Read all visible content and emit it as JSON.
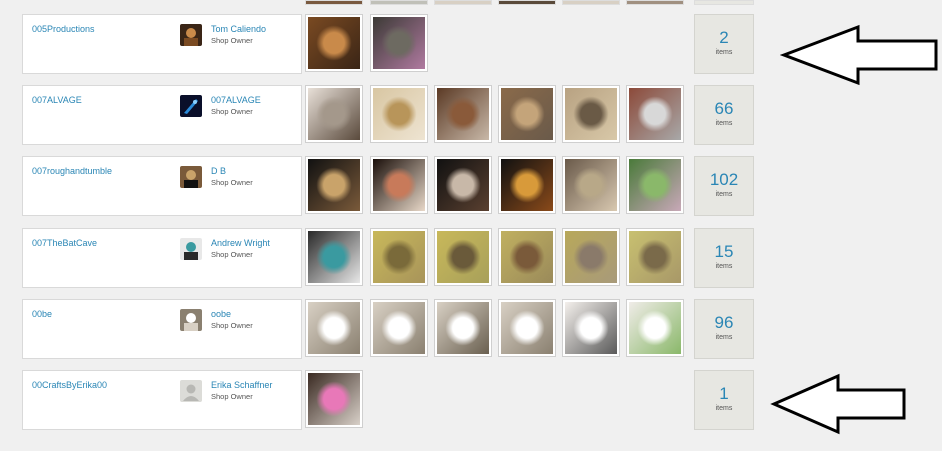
{
  "shops": [
    {
      "shop_name": "005Productions",
      "owner_name": "Tom Caliendo",
      "owner_role": "Shop Owner",
      "avatar_icon": "user-photo-icon",
      "thumbs": [
        {
          "alt": "listing-photo",
          "colors": [
            "#7a4a22",
            "#c98a4a",
            "#3a2516"
          ]
        },
        {
          "alt": "listing-photo",
          "colors": [
            "#3c3a36",
            "#6d6a61",
            "#b07aa0"
          ]
        }
      ],
      "item_count": "2",
      "items_label": "items",
      "highlight": true
    },
    {
      "shop_name": "007ALVAGE",
      "owner_name": "007ALVAGE",
      "owner_role": "Shop Owner",
      "avatar_icon": "blue-logo-icon",
      "thumbs": [
        {
          "alt": "listing-photo",
          "colors": [
            "#e8e0d8",
            "#a4988b",
            "#5a4a3c"
          ]
        },
        {
          "alt": "listing-photo",
          "colors": [
            "#d8c6a2",
            "#b8955a",
            "#eee4d2"
          ]
        },
        {
          "alt": "listing-photo",
          "colors": [
            "#5b3a25",
            "#8a5a3a",
            "#c8b8a8"
          ]
        },
        {
          "alt": "listing-photo",
          "colors": [
            "#8a6a4a",
            "#c4a47a",
            "#6a5a4a"
          ]
        },
        {
          "alt": "listing-photo",
          "colors": [
            "#b8a282",
            "#6a5a46",
            "#d8c8a8"
          ]
        },
        {
          "alt": "listing-photo",
          "colors": [
            "#8c4a3a",
            "#d8d8d8",
            "#a8a8a8"
          ]
        }
      ],
      "item_count": "66",
      "items_label": "items",
      "highlight": false
    },
    {
      "shop_name": "007roughandtumble",
      "owner_name": "D B",
      "owner_role": "Shop Owner",
      "avatar_icon": "user-photo-icon",
      "thumbs": [
        {
          "alt": "listing-photo",
          "colors": [
            "#111111",
            "#c9a36a",
            "#7a5a3a"
          ]
        },
        {
          "alt": "listing-photo",
          "colors": [
            "#1a0f0a",
            "#c87a5a",
            "#e8d8c8"
          ]
        },
        {
          "alt": "listing-photo",
          "colors": [
            "#111111",
            "#c8b8a8",
            "#5a4030"
          ]
        },
        {
          "alt": "listing-photo",
          "colors": [
            "#111111",
            "#d89a3a",
            "#8a4a1a"
          ]
        },
        {
          "alt": "listing-photo",
          "colors": [
            "#6a5a4a",
            "#b8a888",
            "#d8c8b0"
          ]
        },
        {
          "alt": "listing-photo",
          "colors": [
            "#4a7a3a",
            "#8ab86a",
            "#c8a8b8"
          ]
        }
      ],
      "item_count": "102",
      "items_label": "items",
      "highlight": false
    },
    {
      "shop_name": "007TheBatCave",
      "owner_name": "Andrew Wright",
      "owner_role": "Shop Owner",
      "avatar_icon": "user-photo-icon",
      "thumbs": [
        {
          "alt": "listing-photo",
          "colors": [
            "#2a2a2a",
            "#3a9aa0",
            "#e8e8e8"
          ]
        },
        {
          "alt": "listing-photo",
          "colors": [
            "#c8b85a",
            "#7a6a3a",
            "#a8945a"
          ]
        },
        {
          "alt": "listing-photo",
          "colors": [
            "#c8b85a",
            "#6a5a3a",
            "#a8a05a"
          ]
        },
        {
          "alt": "listing-photo",
          "colors": [
            "#c0b060",
            "#7a5a3a",
            "#9a8a5a"
          ]
        },
        {
          "alt": "listing-photo",
          "colors": [
            "#b8a85a",
            "#8a7a6a",
            "#a89a7a"
          ]
        },
        {
          "alt": "listing-photo",
          "colors": [
            "#c8c070",
            "#7a6a4a",
            "#a89868"
          ]
        }
      ],
      "item_count": "15",
      "items_label": "items",
      "highlight": false
    },
    {
      "shop_name": "00be",
      "owner_name": "oobe",
      "owner_role": "Shop Owner",
      "avatar_icon": "user-photo-icon",
      "thumbs": [
        {
          "alt": "listing-photo",
          "colors": [
            "#d8d0c4",
            "#ffffff",
            "#8a8070"
          ]
        },
        {
          "alt": "listing-photo",
          "colors": [
            "#d8d0c4",
            "#ffffff",
            "#8a8070"
          ]
        },
        {
          "alt": "listing-photo",
          "colors": [
            "#d8d0c4",
            "#ffffff",
            "#6a6050"
          ]
        },
        {
          "alt": "listing-photo",
          "colors": [
            "#d8d0c4",
            "#ffffff",
            "#8a8070"
          ]
        },
        {
          "alt": "listing-photo",
          "colors": [
            "#f4f0ec",
            "#ffffff",
            "#5a5a5a"
          ]
        },
        {
          "alt": "listing-photo",
          "colors": [
            "#f0ece8",
            "#ffffff",
            "#8ab86a"
          ]
        }
      ],
      "item_count": "96",
      "items_label": "items",
      "highlight": false
    },
    {
      "shop_name": "00CraftsByErika00",
      "owner_name": "Erika Schaffner",
      "owner_role": "Shop Owner",
      "avatar_icon": "default-avatar-icon",
      "thumbs": [
        {
          "alt": "listing-photo",
          "colors": [
            "#3a2a22",
            "#e878b8",
            "#d8d0c8"
          ]
        }
      ],
      "item_count": "1",
      "items_label": "items",
      "highlight": true
    }
  ],
  "colors": {
    "link": "#2a86b5",
    "count_bg": "#e7e7e2",
    "page_bg": "#f0f0f0"
  },
  "annotation_icon": "left-arrow-icon"
}
